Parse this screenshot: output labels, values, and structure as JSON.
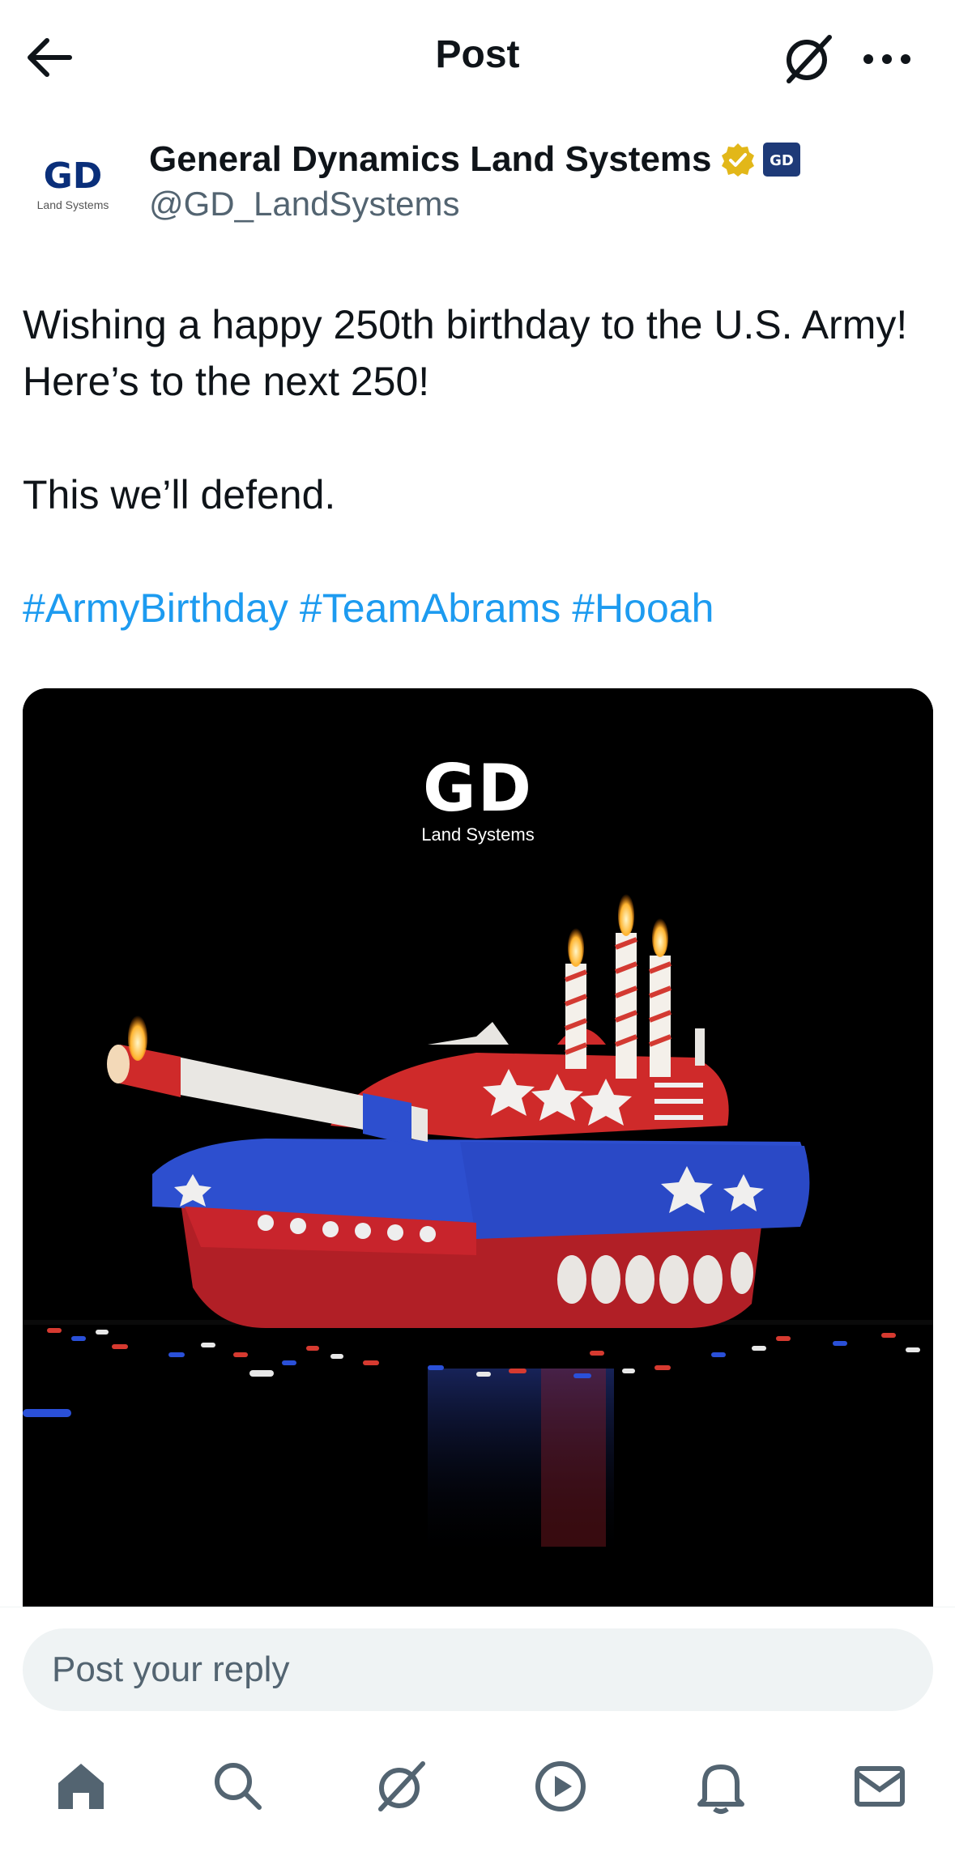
{
  "header": {
    "title": "Post"
  },
  "author": {
    "name": "General Dynamics Land Systems",
    "handle": "@GD_LandSystems",
    "avatar_logo_text": "GD",
    "avatar_logo_subtext": "Land Systems",
    "affiliate_badge_text": "GD"
  },
  "post": {
    "lines": [
      "Wishing a happy 250th birthday to the U.S. Army!",
      "Here’s to the next 250!",
      "This we’ll defend."
    ],
    "hashtags": [
      "#ArmyBirthday",
      "#TeamAbrams",
      "#Hooah"
    ]
  },
  "media": {
    "logo_text": "GD",
    "logo_subtext": "Land Systems"
  },
  "reply": {
    "placeholder": "Post your reply"
  },
  "colors": {
    "link": "#1d9bf0",
    "text": "#0f1419",
    "muted": "#536471",
    "verified": "#e2b719",
    "input_bg": "#eff3f4"
  },
  "icons": {
    "back": "arrow-left-icon",
    "grok": "grok-icon",
    "more": "more-icon",
    "home": "home-icon",
    "search": "search-icon",
    "grok_tab": "grok-icon",
    "video": "play-icon",
    "notifications": "bell-icon",
    "messages": "mail-icon"
  }
}
